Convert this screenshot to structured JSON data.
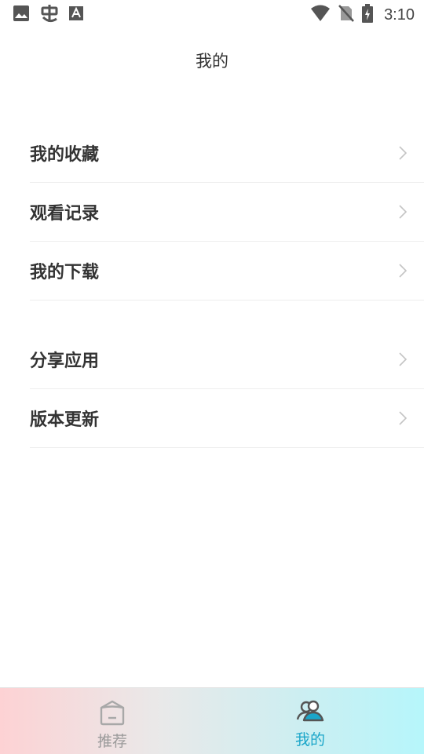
{
  "status_bar": {
    "time": "3:10",
    "icons": [
      "image-icon",
      "bug-icon",
      "font-icon",
      "wifi-icon",
      "no-sim-icon",
      "battery-charging-icon"
    ]
  },
  "header": {
    "title": "我的"
  },
  "menu": {
    "group1": [
      {
        "label": "我的收藏"
      },
      {
        "label": "观看记录"
      },
      {
        "label": "我的下载"
      }
    ],
    "group2": [
      {
        "label": "分享应用"
      },
      {
        "label": "版本更新"
      }
    ]
  },
  "tab_bar": {
    "tabs": [
      {
        "label": "推荐",
        "icon": "box-icon",
        "active": false
      },
      {
        "label": "我的",
        "icon": "users-icon",
        "active": true
      }
    ],
    "active_color": "#1ba6c9",
    "inactive_color": "#9a9a9a"
  }
}
